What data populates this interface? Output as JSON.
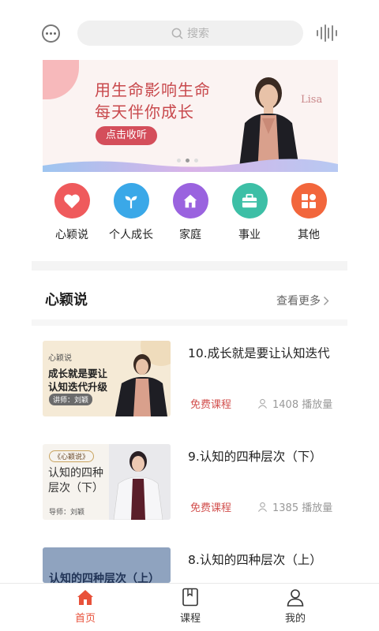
{
  "header": {
    "search_placeholder": "搜索"
  },
  "banner": {
    "line1": "用生命影响生命",
    "line2": "每天伴你成长",
    "button_label": "点击收听",
    "signature": "Lisa"
  },
  "categories": [
    {
      "label": "心颖说",
      "color": "#ef5a5c",
      "icon": "heart-icon"
    },
    {
      "label": "个人成长",
      "color": "#3aa8e8",
      "icon": "sprout-icon"
    },
    {
      "label": "家庭",
      "color": "#9a63df",
      "icon": "home-icon"
    },
    {
      "label": "事业",
      "color": "#3dbfa6",
      "icon": "briefcase-icon"
    },
    {
      "label": "其他",
      "color": "#f2663c",
      "icon": "grid-icon"
    }
  ],
  "section": {
    "title": "心颖说",
    "more_label": "查看更多"
  },
  "courses": [
    {
      "title": "10.成长就是要让认知迭代",
      "price_label": "免费课程",
      "plays": "1408 播放量",
      "thumb": {
        "tag": "心颖说",
        "line1": "成长就是要让",
        "line2": "认知迭代升级",
        "lecturer": "讲师：刘颖"
      }
    },
    {
      "title": "9.认知的四种层次（下）",
      "price_label": "免费课程",
      "plays": "1385 播放量",
      "thumb": {
        "tag": "《心颖说》",
        "line1": "认知的四种",
        "line2": "层次（下）",
        "lecturer": "导师：刘颖"
      }
    },
    {
      "title": "8.认知的四种层次（上）",
      "thumb": {
        "line1": "认知的四种层次（上）"
      }
    }
  ],
  "tabbar": {
    "tabs": [
      {
        "label": "首页",
        "active": true,
        "icon": "home-tab-icon"
      },
      {
        "label": "课程",
        "active": false,
        "icon": "book-tab-icon"
      },
      {
        "label": "我的",
        "active": false,
        "icon": "user-tab-icon"
      }
    ],
    "active_color": "#e8513a"
  }
}
